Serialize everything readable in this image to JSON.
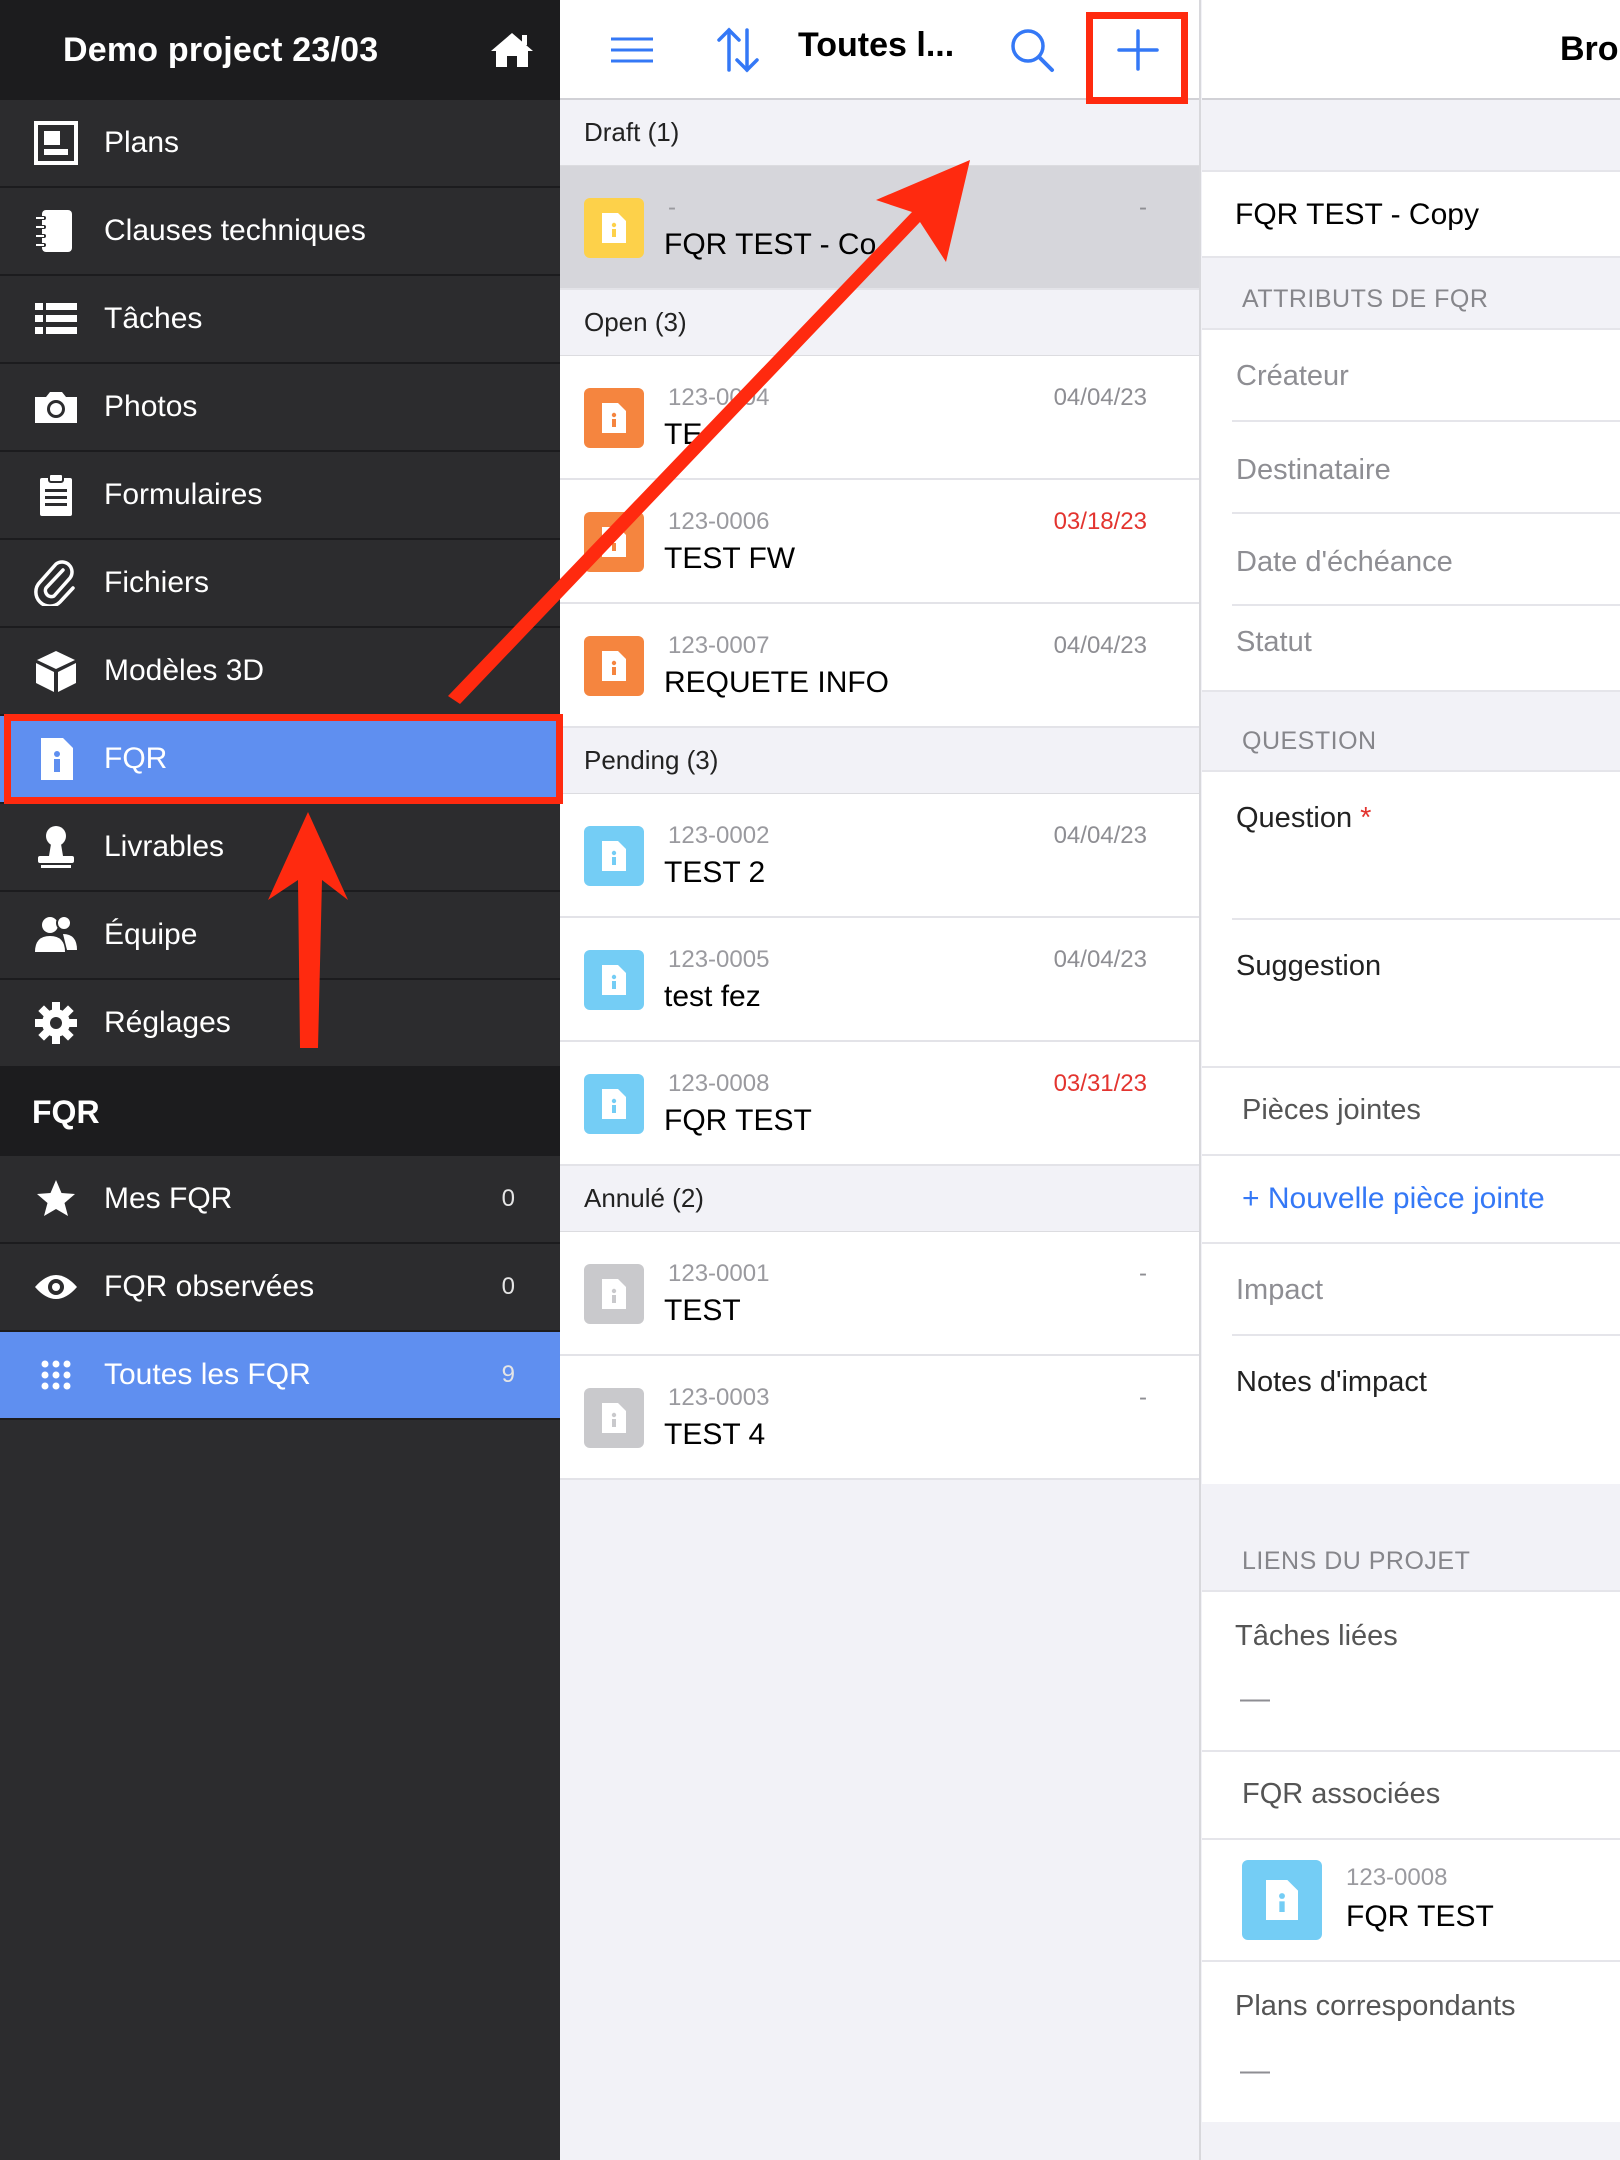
{
  "colors": {
    "accent": "#3478f6",
    "active_row": "#5f8ff0",
    "annotation": "#ff2a0f",
    "overdue": "#e3342f"
  },
  "sidebar": {
    "title": "Demo project  23/03",
    "home_icon": "home-icon",
    "items": [
      {
        "label": "Plans",
        "icon": "plans-icon"
      },
      {
        "label": "Clauses techniques",
        "icon": "notebook-icon"
      },
      {
        "label": "Tâches",
        "icon": "list-icon"
      },
      {
        "label": "Photos",
        "icon": "camera-icon"
      },
      {
        "label": "Formulaires",
        "icon": "clipboard-icon"
      },
      {
        "label": "Fichiers",
        "icon": "paperclip-icon"
      },
      {
        "label": "Modèles 3D",
        "icon": "cube-icon"
      },
      {
        "label": "FQR",
        "icon": "info-doc-icon"
      },
      {
        "label": "Livrables",
        "icon": "stamp-icon"
      },
      {
        "label": "Équipe",
        "icon": "team-icon"
      },
      {
        "label": "Réglages",
        "icon": "gear-icon"
      }
    ],
    "section_title": "FQR",
    "filters": [
      {
        "label": "Mes FQR",
        "count": "0",
        "icon": "star-icon"
      },
      {
        "label": "FQR observées",
        "count": "0",
        "icon": "eye-icon"
      },
      {
        "label": "Toutes les FQR",
        "count": "9",
        "icon": "grid-icon"
      }
    ]
  },
  "list": {
    "title": "Toutes l...",
    "groups": [
      {
        "label": "Draft (1)",
        "rows": [
          {
            "num": "-",
            "name": "FQR TEST - Co",
            "date": "-",
            "status": "draft"
          }
        ]
      },
      {
        "label": "Open (3)",
        "rows": [
          {
            "num": "123-0004",
            "name": "TE",
            "date": "04/04/23",
            "status": "open"
          },
          {
            "num": "123-0006",
            "name": "TEST FW",
            "date": "03/18/23",
            "status": "open",
            "late": true
          },
          {
            "num": "123-0007",
            "name": "REQUETE INFO",
            "date": "04/04/23",
            "status": "open"
          }
        ]
      },
      {
        "label": "Pending (3)",
        "rows": [
          {
            "num": "123-0002",
            "name": "TEST 2",
            "date": "04/04/23",
            "status": "pending"
          },
          {
            "num": "123-0005",
            "name": "test fez",
            "date": "04/04/23",
            "status": "pending"
          },
          {
            "num": "123-0008",
            "name": "FQR TEST",
            "date": "03/31/23",
            "status": "pending",
            "late": true
          }
        ]
      },
      {
        "label": "Annulé (2)",
        "rows": [
          {
            "num": "123-0001",
            "name": "TEST",
            "date": "-",
            "status": "cancelled"
          },
          {
            "num": "123-0003",
            "name": "TEST 4",
            "date": "-",
            "status": "cancelled"
          }
        ]
      }
    ]
  },
  "detail": {
    "header": "Brou",
    "name": "FQR TEST - Copy",
    "attributes_title": "ATTRIBUTS DE FQR",
    "attributes": [
      "Créateur",
      "Destinataire",
      "Date d'échéance",
      "Statut"
    ],
    "question_title": "QUESTION",
    "question_label": "Question",
    "required_mark": "*",
    "suggestion_label": "Suggestion",
    "attachments_label": "Pièces jointes",
    "new_attachment": "+ Nouvelle pièce jointe",
    "impact_label": "Impact",
    "impact_notes_label": "Notes d'impact",
    "links_title": "LIENS DU PROJET",
    "linked_tasks_label": "Tâches liées",
    "linked_tasks_value": "—",
    "associated_label": "FQR associées",
    "associated": {
      "num": "123-0008",
      "name": "FQR TEST"
    },
    "plans_label": "Plans correspondants",
    "plans_value": "—"
  }
}
